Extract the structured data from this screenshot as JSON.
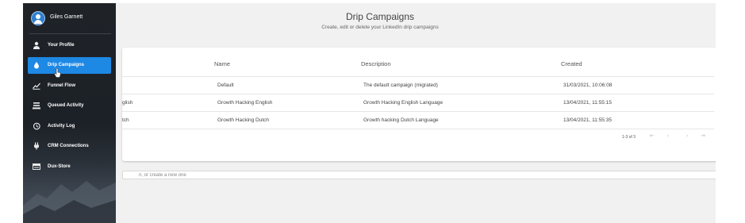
{
  "user": {
    "name": "Giles Garnett"
  },
  "sidebar": {
    "items": [
      {
        "label": "Your Profile",
        "icon": "person-icon",
        "active": false
      },
      {
        "label": "Drip Campaigns",
        "icon": "drop-icon",
        "active": true
      },
      {
        "label": "Funnel Flow",
        "icon": "funnel-icon",
        "active": false
      },
      {
        "label": "Queued Activity",
        "icon": "queue-icon",
        "active": false
      },
      {
        "label": "Activity Log",
        "icon": "history-icon",
        "active": false
      },
      {
        "label": "CRM Connections",
        "icon": "plug-icon",
        "active": false
      },
      {
        "label": "Dux-Store",
        "icon": "store-icon",
        "active": false
      }
    ],
    "active_color": "#1e88e5"
  },
  "main": {
    "title": "Drip Campaigns",
    "subtitle": "Create, edit or delete your LinkedIn drip campaigns",
    "table": {
      "headers": [
        "Name",
        "Description",
        "Created"
      ],
      "rows": [
        {
          "partial": "",
          "name": "Default",
          "description": "The default campaign (migrated)",
          "created": "31/03/2021, 10:06:08"
        },
        {
          "partial": "glish",
          "name": "Growth Hacking English",
          "description": "Growth Hacking English Language",
          "created": "13/04/2021, 11:55:15"
        },
        {
          "partial": "tch",
          "name": "Growth Hacking Dutch",
          "description": "Growth hacking Dutch Language",
          "created": "13/04/2021, 11:55:35"
        }
      ],
      "pagination": "1-3 of 3"
    },
    "search_placeholder_partial": "n, or create a new one"
  }
}
